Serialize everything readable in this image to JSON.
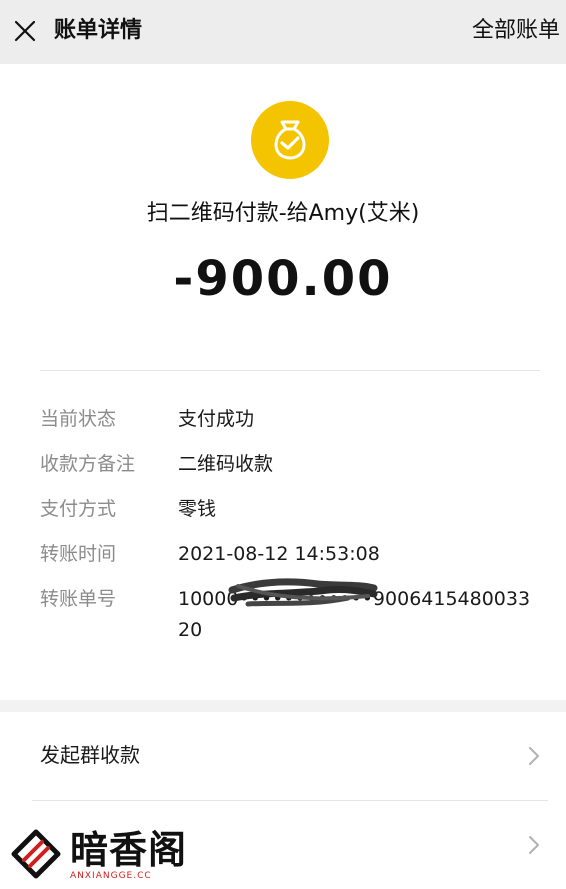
{
  "header": {
    "title": "账单详情",
    "all_bills_label": "全部账单",
    "close_icon": "close-icon"
  },
  "transaction": {
    "icon": "money-bag-check-icon",
    "icon_color": "#F5C400",
    "merchant": "扫二维码付款-给Amy(艾米)",
    "amount": "-900.00"
  },
  "details": [
    {
      "label": "当前状态",
      "value": "支付成功"
    },
    {
      "label": "收款方备注",
      "value": "二维码收款"
    },
    {
      "label": "支付方式",
      "value": "零钱"
    },
    {
      "label": "转账时间",
      "value": "2021-08-12 14:53:08"
    },
    {
      "label": "转账单号",
      "value": "10000••••••••••••9006415480033 20"
    }
  ],
  "actions": [
    {
      "label": "发起群收款",
      "icon": "chevron-right-icon"
    },
    {
      "label": "",
      "icon": "chevron-right-icon"
    }
  ],
  "watermark": {
    "text": "暗香阁",
    "subtext": "ANXIANGGE.CC",
    "color": "#D0201E"
  }
}
